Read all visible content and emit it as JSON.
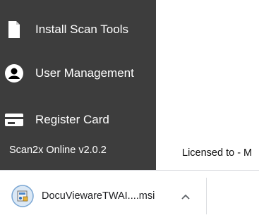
{
  "sidebar": {
    "items": [
      {
        "label": "Install Scan Tools",
        "icon": "document-icon"
      },
      {
        "label": "User Management",
        "icon": "user-icon"
      },
      {
        "label": "Register Card",
        "icon": "credit-card-icon"
      }
    ],
    "version": "Scan2x Online v2.0.2"
  },
  "main": {
    "license_text": "Licensed to - M"
  },
  "download_bar": {
    "file_name": "DocuViewareTWAI....msi",
    "file_icon": "installer-package-icon",
    "menu_icon": "chevron-up-icon"
  },
  "colors": {
    "sidebar_bg": "#3d3d3d",
    "sidebar_text": "#ffffff",
    "download_bar_bg": "#ffffff"
  }
}
